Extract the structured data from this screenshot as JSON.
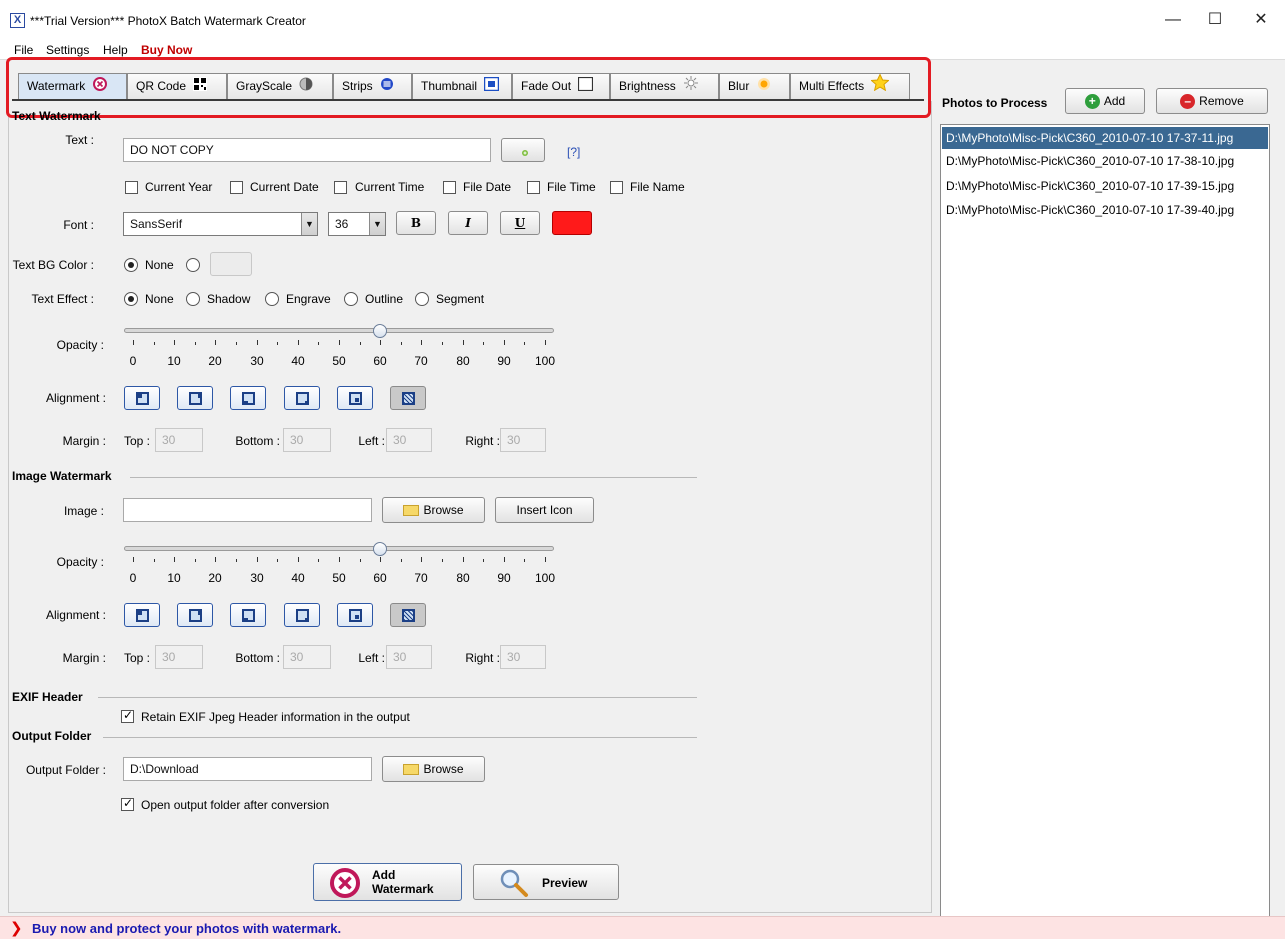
{
  "window": {
    "title": "***Trial Version*** PhotoX Batch Watermark Creator",
    "app_icon": "X",
    "minimize": "—",
    "maximize": "☐",
    "close": "✕"
  },
  "menu": {
    "file": "File",
    "settings": "Settings",
    "help": "Help",
    "buy_now": "Buy Now"
  },
  "tabs": [
    {
      "label": "Watermark",
      "icon": "watermark-icon"
    },
    {
      "label": "QR Code",
      "icon": "qr-code-icon"
    },
    {
      "label": "GrayScale",
      "icon": "grayscale-icon"
    },
    {
      "label": "Strips",
      "icon": "strips-icon"
    },
    {
      "label": "Thumbnail",
      "icon": "thumbnail-icon"
    },
    {
      "label": "Fade Out",
      "icon": "fade-out-icon"
    },
    {
      "label": "Brightness",
      "icon": "brightness-icon"
    },
    {
      "label": "Blur",
      "icon": "blur-icon"
    },
    {
      "label": "Multi Effects",
      "icon": "star-icon"
    }
  ],
  "text_watermark": {
    "section_title": "Text Watermark",
    "text_label": "Text :",
    "text_value": "DO NOT COPY",
    "help_link": "[?]",
    "options": [
      "Current Year",
      "Current Date",
      "Current Time",
      "File Date",
      "File Time",
      "File Name"
    ],
    "font_label": "Font :",
    "font_value": "SansSerif",
    "size_value": "36",
    "bold_label": "B",
    "italic_label": "I",
    "underline_label": "U",
    "text_color": "#ff1a1a",
    "bg_color_label": "Text BG Color :",
    "bg_none": "None",
    "effect_label": "Text Effect :",
    "effects": [
      "None",
      "Shadow",
      "Engrave",
      "Outline",
      "Segment"
    ],
    "opacity_label": "Opacity :",
    "opacity_value": 60,
    "opacity_ticks": [
      "0",
      "10",
      "20",
      "30",
      "40",
      "50",
      "60",
      "70",
      "80",
      "90",
      "100"
    ],
    "alignment_label": "Alignment :",
    "margin_label": "Margin :",
    "top_label": "Top :",
    "top_value": "30",
    "bottom_label": "Bottom :",
    "bottom_value": "30",
    "left_label": "Left :",
    "left_value": "30",
    "right_label": "Right :",
    "right_value": "30"
  },
  "image_watermark": {
    "section_title": "Image Watermark",
    "image_label": "Image :",
    "image_value": "",
    "browse_label": "Browse",
    "insert_icon_label": "Insert Icon",
    "opacity_label": "Opacity :",
    "opacity_value": 60,
    "alignment_label": "Alignment :",
    "margin_label": "Margin :",
    "top_label": "Top :",
    "top_value": "30",
    "bottom_label": "Bottom :",
    "bottom_value": "30",
    "left_label": "Left :",
    "left_value": "30",
    "right_label": "Right :",
    "right_value": "30"
  },
  "exif": {
    "section_title": "EXIF Header",
    "retain_label": "Retain EXIF Jpeg Header information in the output"
  },
  "output": {
    "section_title": "Output Folder",
    "folder_label": "Output Folder :",
    "folder_value": "D:\\Download",
    "browse_label": "Browse",
    "open_after_label": "Open output folder after conversion"
  },
  "actions": {
    "add_watermark_line1": "Add",
    "add_watermark_line2": "Watermark",
    "preview": "Preview"
  },
  "photos": {
    "title": "Photos to Process",
    "add_label": "Add",
    "remove_label": "Remove",
    "items": [
      "D:\\MyPhoto\\Misc-Pick\\C360_2010-07-10 17-37-11.jpg",
      "D:\\MyPhoto\\Misc-Pick\\C360_2010-07-10 17-38-10.jpg",
      "D:\\MyPhoto\\Misc-Pick\\C360_2010-07-10 17-39-15.jpg",
      "D:\\MyPhoto\\Misc-Pick\\C360_2010-07-10 17-39-40.jpg"
    ]
  },
  "status": {
    "arrow": "❯",
    "message": "Buy now and protect your photos with watermark."
  }
}
